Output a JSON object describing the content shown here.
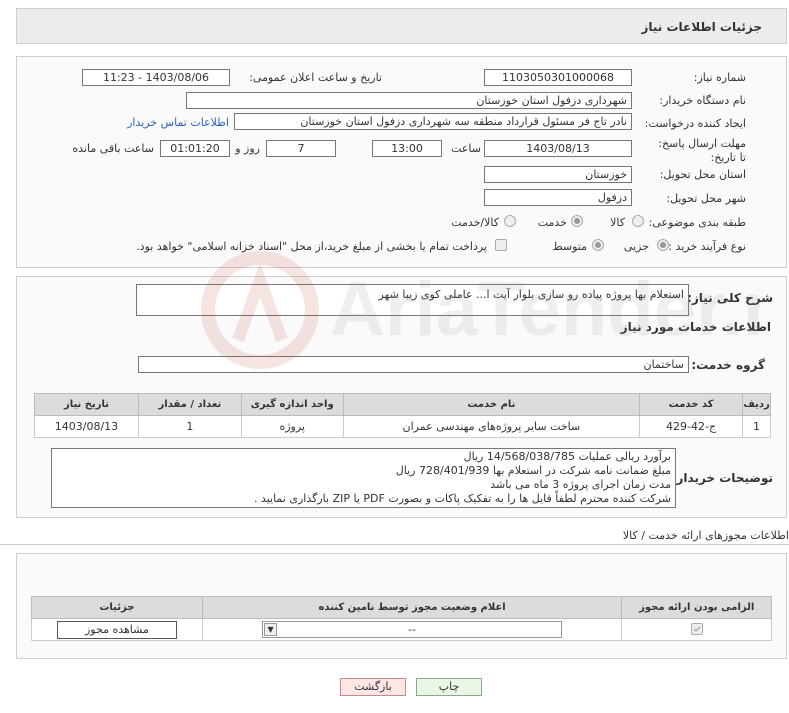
{
  "header": {
    "title": "جزئیات اطلاعات نیاز"
  },
  "fields": {
    "need_number_label": "شماره نیاز:",
    "need_number": "1103050301000068",
    "announce_label": "تاریخ و ساعت اعلان عمومی:",
    "announce_value": "1403/08/06 - 11:23",
    "buyer_label": "نام دستگاه خریدار:",
    "buyer_value": "شهرداری دزفول استان خوزستان",
    "creator_label": "ایجاد کننده درخواست:",
    "creator_value": "نادر تاج فر مسئول قرارداد منطقه سه شهرداری دزفول استان خوزستان",
    "contact_link": "اطلاعات تماس خریدار",
    "deadline_label": "مهلت ارسال پاسخ: تا تاریخ:",
    "deadline_date": "1403/08/13",
    "time_label": "ساعت",
    "deadline_time": "13:00",
    "days_value": "7",
    "days_label": "روز و",
    "remaining_time": "01:01:20",
    "remaining_label": "ساعت باقی مانده",
    "province_label": "استان محل تحویل:",
    "province_value": "خوزستان",
    "city_label": "شهر محل تحویل:",
    "city_value": "دزفول",
    "category_label": "طبقه بندی موضوعی:",
    "category_options": [
      "کالا",
      "خدمت",
      "کالا/خدمت"
    ],
    "category_selected": "خدمت",
    "process_label": "نوع فرآیند خرید :",
    "process_options": [
      "جزیی",
      "متوسط"
    ],
    "process_selected": "جزیی",
    "treasury_note": "پرداخت تمام یا بخشی از مبلغ خرید،از محل \"اسناد خزانه اسلامی\" خواهد بود."
  },
  "summary": {
    "label": "شرح کلی نیاز:",
    "value": "استعلام بها پروژه پیاده رو سازی بلوار آیت ا... عاملی کوی زیبا شهر",
    "services_heading": "اطلاعات خدمات مورد نیاز",
    "group_label": "گروه خدمت:",
    "group_value": "ساختمان"
  },
  "services_table": {
    "headers": [
      "ردیف",
      "کد خدمت",
      "نام خدمت",
      "واحد اندازه گیری",
      "تعداد / مقدار",
      "تاریخ نیاز"
    ],
    "rows": [
      [
        "1",
        "ج-42-429",
        "ساخت سایر پروژه‌های مهندسی عمران",
        "پروژه",
        "1",
        "1403/08/13"
      ]
    ]
  },
  "buyer_notes": {
    "label": "توضیحات خریدار:",
    "lines": [
      "برآورد ریالی عملیات 14/568/038/785 ریال",
      "مبلغ ضمانت نامه شرکت در استعلام بها 728/401/939 ریال",
      "مدت زمان اجرای پروژه 3 ماه می باشد",
      "شرکت کننده محترم لطفاً فایل ها را به تفکیک پاکات و بصورت PDF یا ZIP بارگذاری نمایید ."
    ]
  },
  "permits": {
    "heading": "اطلاعات مجوزهای ارائه خدمت / کالا",
    "headers": [
      "الزامی بودن ارائه مجوز",
      "اعلام وضعیت مجوز توسط نامین کننده",
      "جزئیات"
    ],
    "select_value": "--",
    "view_button": "مشاهده مجوز"
  },
  "buttons": {
    "print": "چاپ",
    "back": "بازگشت"
  },
  "watermark": "AriaTender.neT"
}
